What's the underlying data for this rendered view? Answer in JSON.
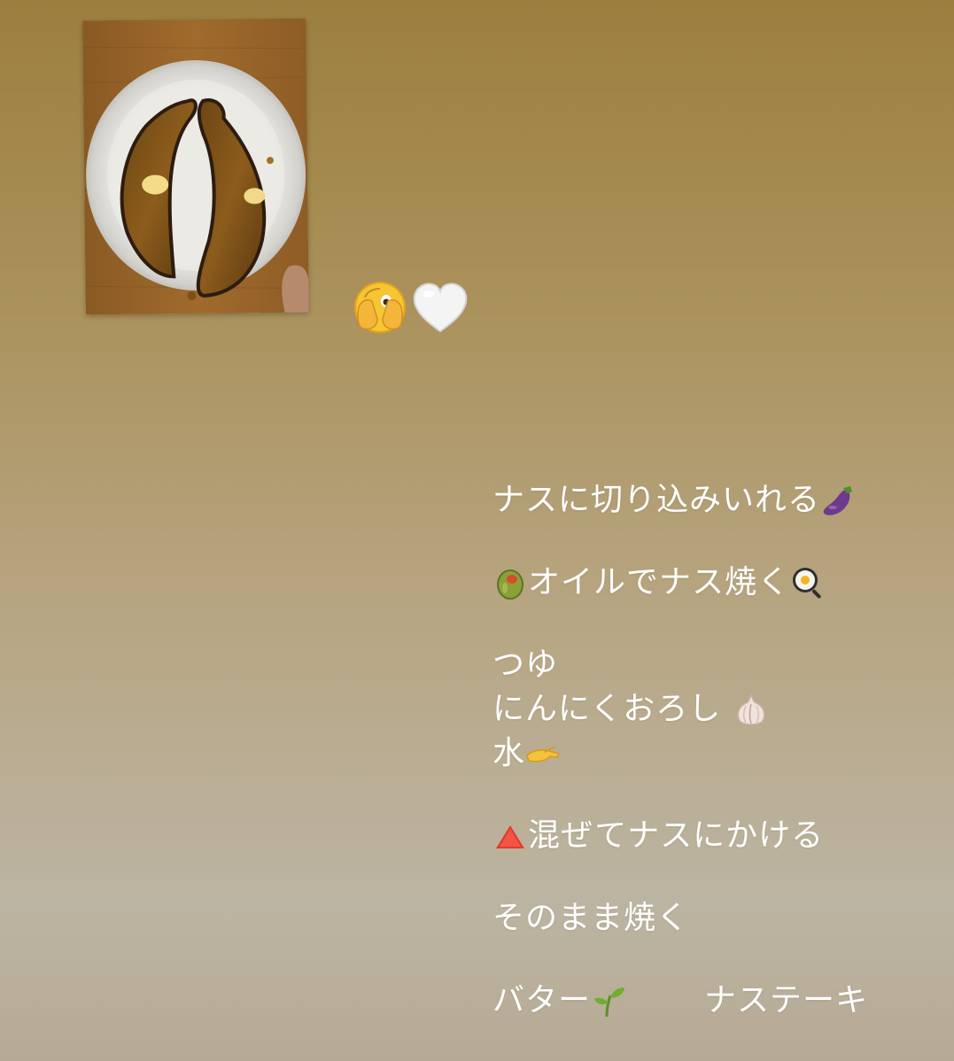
{
  "photo": {
    "description_icon": "eggplant-steak-photo"
  },
  "reactions": {
    "icons": [
      "face-peeking-hands-icon",
      "white-heart-icon"
    ]
  },
  "recipe": {
    "line1": "ナスに切り込みいれる",
    "line1_icon": "eggplant-icon",
    "line2_icon_before": "olive-icon",
    "line2": "オイルでナス焼く",
    "line2_icon_after": "frying-pan-egg-icon",
    "line3": "つゆ",
    "line4": "にんにくおろし",
    "line4_icon": "garlic-icon",
    "line5": "水",
    "line5_icon": "pinching-hand-icon",
    "line6_icon": "red-triangle-icon",
    "line6": "混ぜてナスにかける",
    "line7": "そのまま焼く",
    "line8_part1": "バター",
    "line8_icon": "seedling-icon",
    "line8_part2": "ナステーキ"
  },
  "colors": {
    "text": "#ffffff",
    "bg_top": "#9c7f3f",
    "bg_bottom": "#b6aa94"
  }
}
